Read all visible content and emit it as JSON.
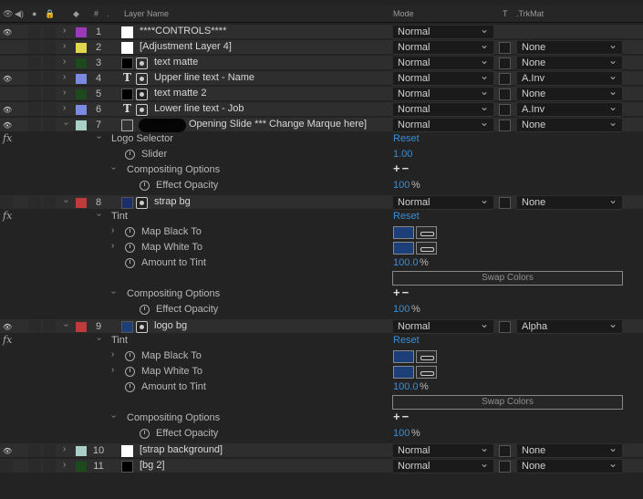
{
  "header": {
    "layer_name": "Layer Name",
    "mode": "Mode",
    "t": "T",
    "trkmat": ".TrkMat",
    "hash": "#"
  },
  "colors": {
    "purple": "#9a3ab8",
    "yellow": "#e0d84a",
    "darkgreen": "#1d4a1d",
    "periwinkle": "#7a8ae0",
    "lightteal": "#a9cfc6",
    "red": "#c0393b",
    "link_blue": "#3a8fd9"
  },
  "layers": [
    {
      "num": "1",
      "name": "****CONTROLS****",
      "mode": "Normal",
      "trkmat": ""
    },
    {
      "num": "2",
      "name": "[Adjustment Layer 4]",
      "mode": "Normal",
      "trkmat": "None"
    },
    {
      "num": "3",
      "name": "text matte",
      "mode": "Normal",
      "trkmat": "None"
    },
    {
      "num": "4",
      "name": "Upper line text - Name",
      "mode": "Normal",
      "trkmat": "A.Inv"
    },
    {
      "num": "5",
      "name": "text matte 2",
      "mode": "Normal",
      "trkmat": "None"
    },
    {
      "num": "6",
      "name": "Lower line text - Job",
      "mode": "Normal",
      "trkmat": "A.Inv"
    },
    {
      "num": "7",
      "name": "Opening Slide *** Change Marque here]",
      "mode": "Normal",
      "trkmat": "None"
    },
    {
      "num": "8",
      "name": "strap bg",
      "mode": "Normal",
      "trkmat": "None"
    },
    {
      "num": "9",
      "name": "logo bg",
      "mode": "Normal",
      "trkmat": "Alpha"
    },
    {
      "num": "10",
      "name": "[strap background]",
      "mode": "Normal",
      "trkmat": "None"
    },
    {
      "num": "11",
      "name": "[bg 2]",
      "mode": "Normal",
      "trkmat": "None"
    }
  ],
  "fx7": {
    "effect": "Logo Selector",
    "reset": "Reset",
    "slider_label": "Slider",
    "slider_value": "1.00",
    "compositing": "Compositing Options",
    "plusminus": "+−",
    "opacity_label": "Effect Opacity",
    "opacity_value": "100",
    "unit": "%"
  },
  "fx8": {
    "effect": "Tint",
    "reset": "Reset",
    "map_black": "Map Black To",
    "map_white": "Map White To",
    "amount_label": "Amount to Tint",
    "amount_value": "100.0",
    "unit": "%",
    "swap": "Swap Colors",
    "compositing": "Compositing Options",
    "plusminus": "+−",
    "opacity_label": "Effect Opacity",
    "opacity_value": "100"
  },
  "fx9": {
    "effect": "Tint",
    "reset": "Reset",
    "map_black": "Map Black To",
    "map_white": "Map White To",
    "amount_label": "Amount to Tint",
    "amount_value": "100.0",
    "unit": "%",
    "swap": "Swap Colors",
    "compositing": "Compositing Options",
    "plusminus": "+−",
    "opacity_label": "Effect Opacity",
    "opacity_value": "100"
  },
  "fx_label": "fx"
}
